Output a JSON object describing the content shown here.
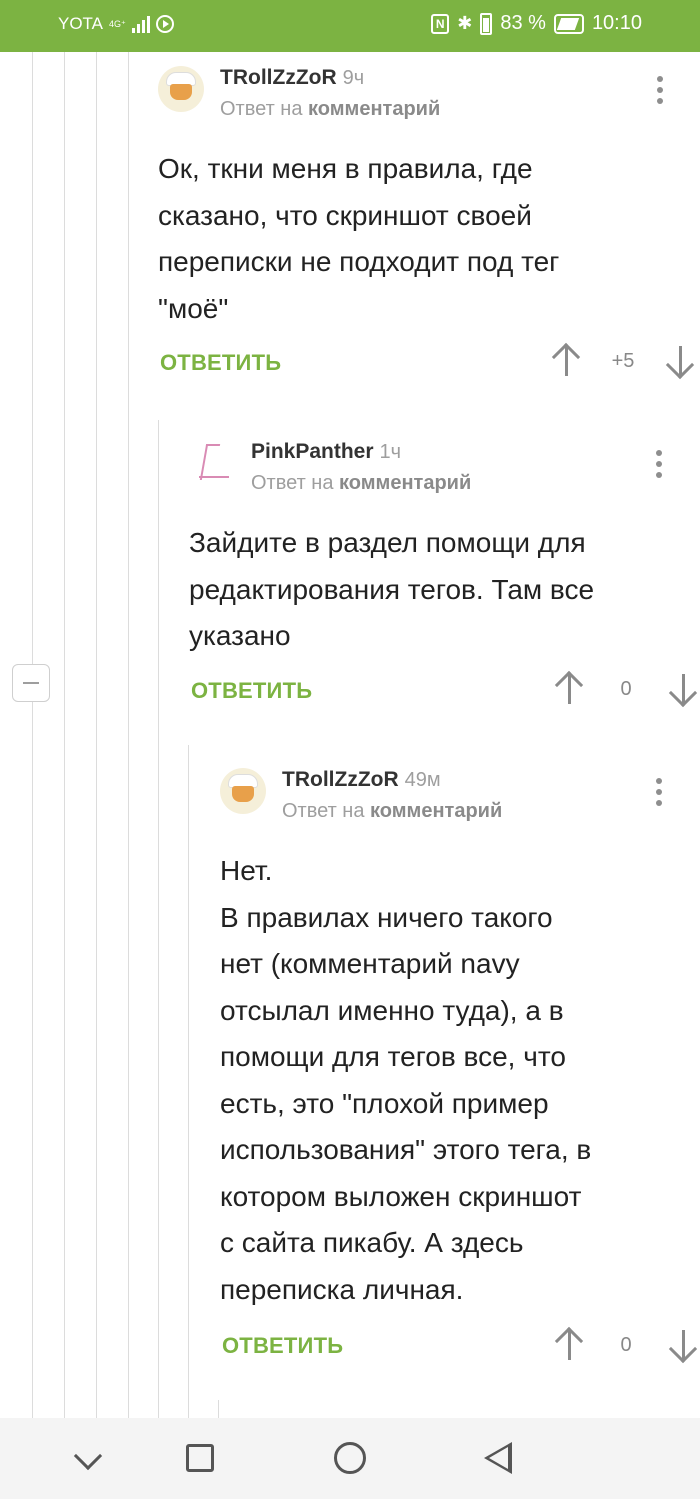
{
  "status_bar": {
    "carrier": "YOTA",
    "network": "4G⁺",
    "battery": "83 %",
    "time": "10:10"
  },
  "comments": [
    {
      "username": "TRollZzZoR",
      "time": "9ч",
      "reply_prefix": "Ответ на",
      "reply_link": "комментарий",
      "text": "Ок, ткни меня в правила, где\nсказано, что скриншот своей\nпереписки не подходит под тег\n\"моё\"",
      "reply_label": "ОТВЕТИТЬ",
      "score": "+5"
    },
    {
      "username": "PinkPanther",
      "time": "1ч",
      "reply_prefix": "Ответ на",
      "reply_link": "комментарий",
      "text": "Зайдите в раздел помощи для\nредактирования тегов. Там все\nуказано",
      "reply_label": "ОТВЕТИТЬ",
      "score": "0"
    },
    {
      "username": "TRollZzZoR",
      "time": "49м",
      "reply_prefix": "Ответ на",
      "reply_link": "комментарий",
      "text": "Нет.\nВ правилах ничего такого\nнет (комментарий navy\nотсылал именно туда), а в\nпомощи для тегов все, что\nесть, это \"плохой пример\nиспользования\" этого тега, в\nкотором выложен скриншот\nс сайта пикабу. А здесь\nпереписка личная.",
      "reply_label": "ОТВЕТИТЬ",
      "score": "0"
    }
  ],
  "nav_bar": {
    "icons": [
      "back-chevron-icon",
      "recents-square-icon",
      "home-circle-icon",
      "back-triangle-icon"
    ]
  }
}
